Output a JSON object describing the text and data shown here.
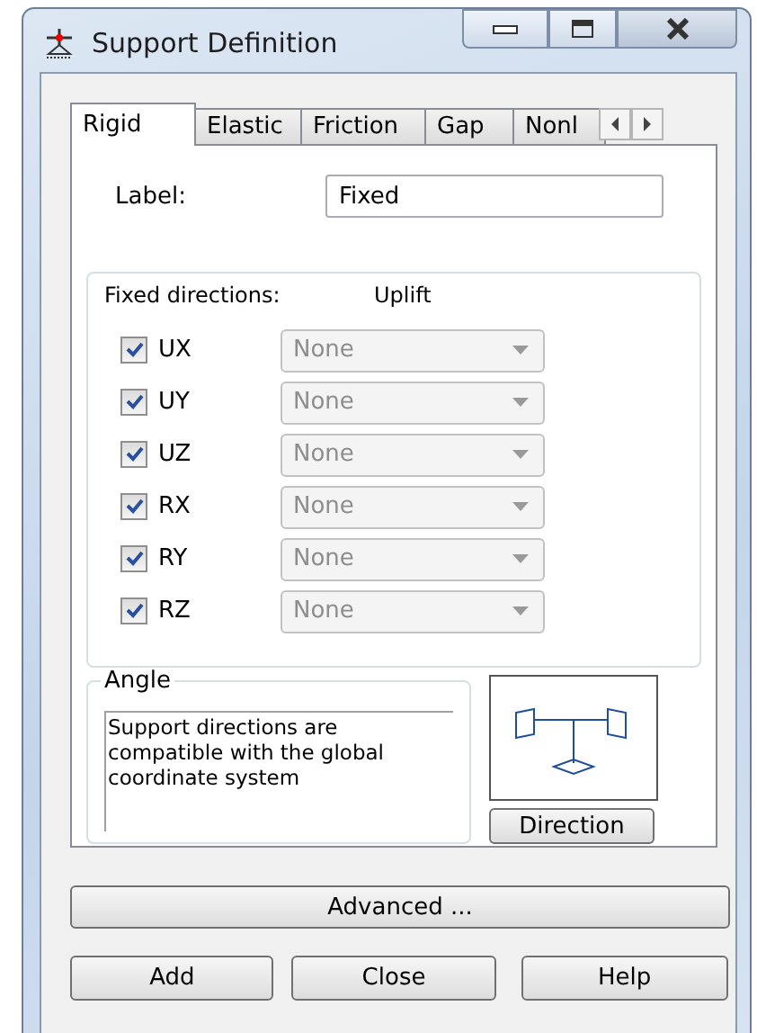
{
  "window": {
    "title": "Support Definition"
  },
  "tabs": [
    {
      "label": "Rigid",
      "selected": true
    },
    {
      "label": "Elastic",
      "selected": false
    },
    {
      "label": "Friction",
      "selected": false
    },
    {
      "label": "Gap",
      "selected": false
    },
    {
      "label": "Nonl",
      "selected": false
    }
  ],
  "label_field": {
    "label": "Label:",
    "value": "Fixed"
  },
  "directions": {
    "heading": "Fixed directions:",
    "uplift_heading": "Uplift",
    "rows": [
      {
        "name": "UX",
        "checked": true,
        "uplift": "None",
        "disabled": true
      },
      {
        "name": "UY",
        "checked": true,
        "uplift": "None",
        "disabled": true
      },
      {
        "name": "UZ",
        "checked": true,
        "uplift": "None",
        "disabled": true
      },
      {
        "name": "RX",
        "checked": true,
        "uplift": "None",
        "disabled": true
      },
      {
        "name": "RY",
        "checked": true,
        "uplift": "None",
        "disabled": true
      },
      {
        "name": "RZ",
        "checked": true,
        "uplift": "None",
        "disabled": true
      }
    ]
  },
  "angle": {
    "title": "Angle",
    "text": "Support directions are compatible with the global coordinate system"
  },
  "direction_button": "Direction",
  "advanced_button": "Advanced ...",
  "buttons": [
    "Add",
    "Close",
    "Help"
  ]
}
